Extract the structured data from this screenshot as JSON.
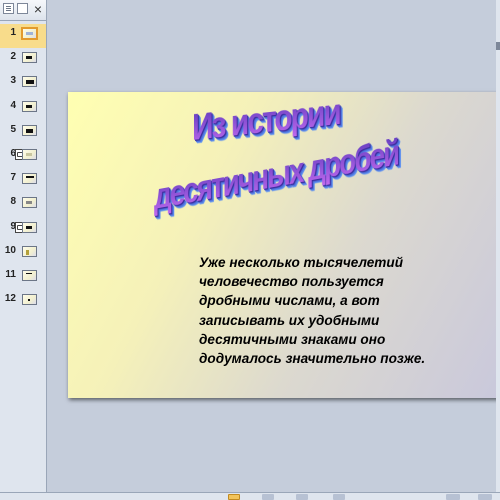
{
  "pane": {
    "close_glyph": "×",
    "active_slide": 1,
    "slides": [
      {
        "number": "1"
      },
      {
        "number": "2"
      },
      {
        "number": "3"
      },
      {
        "number": "4"
      },
      {
        "number": "5"
      },
      {
        "number": "6"
      },
      {
        "number": "7"
      },
      {
        "number": "8"
      },
      {
        "number": "9"
      },
      {
        "number": "10"
      },
      {
        "number": "11"
      },
      {
        "number": "12"
      }
    ]
  },
  "slide": {
    "title_line1": "Из истории",
    "title_line2": "десятичных дробей",
    "body_lines": [
      "Уже несколько тысячелетий",
      "человечество пользуется",
      "дробными числами, а вот",
      "записывать их удобными",
      "десятичными знаками оно",
      "додумалось значительно позже."
    ],
    "background_colors": [
      "#ffffb2",
      "#c9c8dc"
    ],
    "title_color": "#6f43c9"
  }
}
